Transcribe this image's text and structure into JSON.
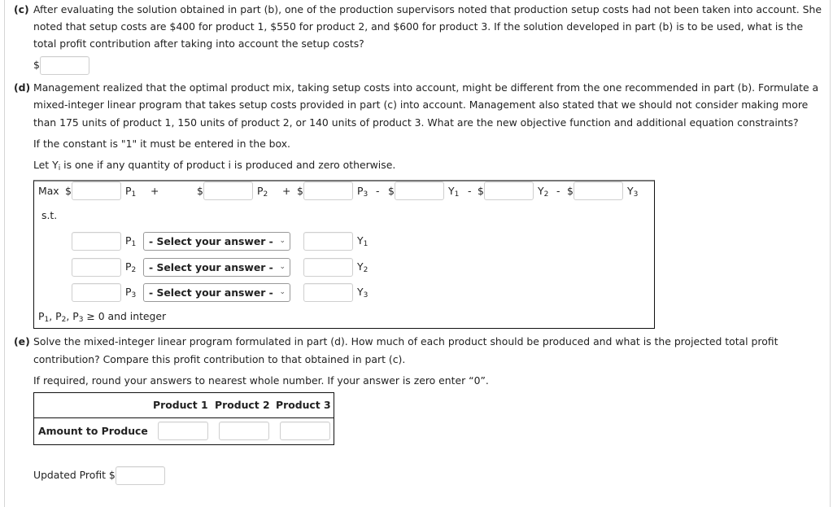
{
  "part_c": {
    "label": "(c)",
    "lines": [
      "After evaluating the solution obtained in part (b), one of the production supervisors noted that production setup costs had not been taken into account. She",
      "noted that setup costs are $400 for product 1, $550 for product 2, and $600 for product 3. If the solution developed in part (b) is to be used, what is the",
      "total profit contribution after taking into account the setup costs?"
    ],
    "currency": "$",
    "answer_value": ""
  },
  "part_d": {
    "label": "(d)",
    "lines": [
      "Management realized that the optimal product mix, taking setup costs into account, might be different from the one recommended in part (b). Formulate a",
      "mixed-integer linear program that takes setup costs provided in part (c) into account. Management also stated that we should not consider making more",
      "than 175 units of product 1, 150 units of product 2, or 140 units of product 3. What are the new objective function and additional equation constraints?"
    ],
    "note_constant": "If the constant is \"1\" it must be entered in the box.",
    "note_yi": {
      "pre": "Let Y",
      "sub": "i",
      "post": " is one if any quantity of product i is produced and zero otherwise."
    },
    "objective": {
      "max_label": "Max",
      "currency": "$",
      "plus": "+",
      "minus": "-",
      "terms": [
        {
          "var": "P",
          "sub": "1",
          "value": ""
        },
        {
          "var": "P",
          "sub": "2",
          "value": ""
        },
        {
          "var": "P",
          "sub": "3",
          "value": ""
        },
        {
          "var": "Y",
          "sub": "1",
          "value": ""
        },
        {
          "var": "Y",
          "sub": "2",
          "value": ""
        },
        {
          "var": "Y",
          "sub": "3",
          "value": ""
        }
      ]
    },
    "st_label": "s.t.",
    "constraints": [
      {
        "var": "P",
        "sub": "1",
        "coef": "",
        "select": "- Select your answer -",
        "rhs": "",
        "rhs_var": "Y",
        "rhs_sub": "1"
      },
      {
        "var": "P",
        "sub": "2",
        "coef": "",
        "select": "- Select your answer -",
        "rhs": "",
        "rhs_var": "Y",
        "rhs_sub": "2"
      },
      {
        "var": "P",
        "sub": "3",
        "coef": "",
        "select": "- Select your answer -",
        "rhs": "",
        "rhs_var": "Y",
        "rhs_sub": "3"
      }
    ],
    "nonneg": {
      "P": "P",
      "s1": "1",
      "s2": "2",
      "s3": "3",
      "tail": " ≥ 0 and integer",
      "sep": ", "
    }
  },
  "part_e": {
    "label": "(e)",
    "lines": [
      "Solve the mixed-integer linear program formulated in part (d). How much of each product should be produced and what is the projected total profit",
      "contribution? Compare this profit contribution to that obtained in part (c)."
    ],
    "note": "If required, round your answers to nearest whole number. If your answer is zero enter “0”.",
    "table": {
      "columns": [
        "Product 1",
        "Product 2",
        "Product 3"
      ],
      "row_label": "Amount to Produce",
      "values": [
        "",
        "",
        ""
      ]
    },
    "updated_profit_label": "Updated Profit $",
    "updated_profit_value": ""
  },
  "icons": {
    "chevron": "⌄"
  }
}
